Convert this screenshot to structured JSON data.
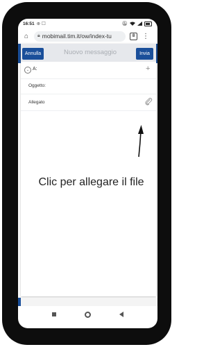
{
  "status_bar": {
    "time": "16:51",
    "left_icons": "⊕ ☐",
    "right_icons": [
      "mute-icon",
      "wifi-icon",
      "signal-icon",
      "battery-icon"
    ]
  },
  "browser": {
    "url": "mobimail.tim.it/ow/index-tu",
    "tab_count": "8"
  },
  "compose": {
    "cancel_label": "Annulla",
    "title": "Nuovo messaggio",
    "send_label": "Invia",
    "to_label": "A:",
    "subject_label": "Oggetto:",
    "attachment_label": "Allegato"
  },
  "annotation": {
    "text": "Clic per allegare il file"
  },
  "colors": {
    "accent": "#1a4f9a",
    "phone_frame": "#0d0d0d"
  }
}
